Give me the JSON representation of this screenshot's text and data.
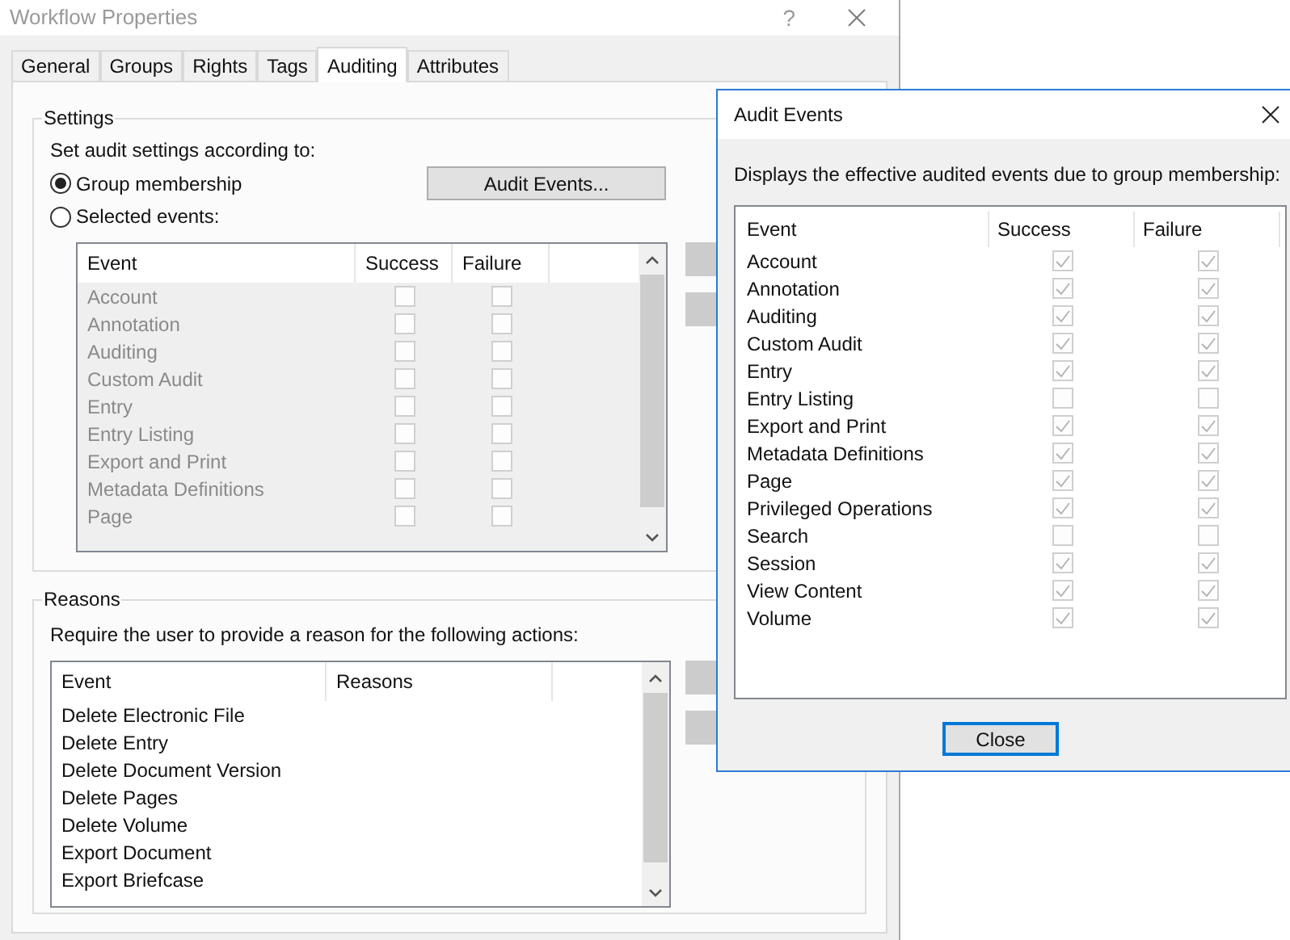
{
  "window": {
    "title": "Workflow Properties",
    "help_button": "?"
  },
  "tabs": [
    {
      "label": "General",
      "selected": false
    },
    {
      "label": "Groups",
      "selected": false
    },
    {
      "label": "Rights",
      "selected": false
    },
    {
      "label": "Tags",
      "selected": false
    },
    {
      "label": "Auditing",
      "selected": true
    },
    {
      "label": "Attributes",
      "selected": false
    }
  ],
  "settings": {
    "title": "Settings",
    "prompt": "Set audit settings according to:",
    "options": [
      {
        "label": "Group membership",
        "selected": true
      },
      {
        "label": "Selected events:",
        "selected": false
      }
    ],
    "audit_events_button": "Audit Events...",
    "table": {
      "disabled": true,
      "columns": [
        "Event",
        "Success",
        "Failure"
      ],
      "rows": [
        {
          "event": "Account",
          "success": false,
          "failure": false
        },
        {
          "event": "Annotation",
          "success": false,
          "failure": false
        },
        {
          "event": "Auditing",
          "success": false,
          "failure": false
        },
        {
          "event": "Custom Audit",
          "success": false,
          "failure": false
        },
        {
          "event": "Entry",
          "success": false,
          "failure": false
        },
        {
          "event": "Entry Listing",
          "success": false,
          "failure": false
        },
        {
          "event": "Export and Print",
          "success": false,
          "failure": false
        },
        {
          "event": "Metadata Definitions",
          "success": false,
          "failure": false
        },
        {
          "event": "Page",
          "success": false,
          "failure": false
        }
      ]
    }
  },
  "reasons": {
    "title": "Reasons",
    "prompt": "Require the user to provide a reason for the following actions:",
    "table": {
      "columns": [
        "Event",
        "Reasons"
      ],
      "rows": [
        {
          "event": "Delete Electronic File"
        },
        {
          "event": "Delete Entry"
        },
        {
          "event": "Delete Document Version"
        },
        {
          "event": "Delete Pages"
        },
        {
          "event": "Delete Volume"
        },
        {
          "event": "Export Document"
        },
        {
          "event": "Export Briefcase"
        }
      ]
    }
  },
  "dialog": {
    "title": "Audit Events",
    "description": "Displays the effective audited events due to group membership:",
    "table": {
      "columns": [
        "Event",
        "Success",
        "Failure"
      ],
      "rows": [
        {
          "event": "Account",
          "success": true,
          "failure": true
        },
        {
          "event": "Annotation",
          "success": true,
          "failure": true
        },
        {
          "event": "Auditing",
          "success": true,
          "failure": true
        },
        {
          "event": "Custom Audit",
          "success": true,
          "failure": true
        },
        {
          "event": "Entry",
          "success": true,
          "failure": true
        },
        {
          "event": "Entry Listing",
          "success": false,
          "failure": false
        },
        {
          "event": "Export and Print",
          "success": true,
          "failure": true
        },
        {
          "event": "Metadata Definitions",
          "success": true,
          "failure": true
        },
        {
          "event": "Page",
          "success": true,
          "failure": true
        },
        {
          "event": "Privileged Operations",
          "success": true,
          "failure": true
        },
        {
          "event": "Search",
          "success": false,
          "failure": false
        },
        {
          "event": "Session",
          "success": true,
          "failure": true
        },
        {
          "event": "View Content",
          "success": true,
          "failure": true
        },
        {
          "event": "Volume",
          "success": true,
          "failure": true
        }
      ]
    },
    "close_button": "Close"
  }
}
